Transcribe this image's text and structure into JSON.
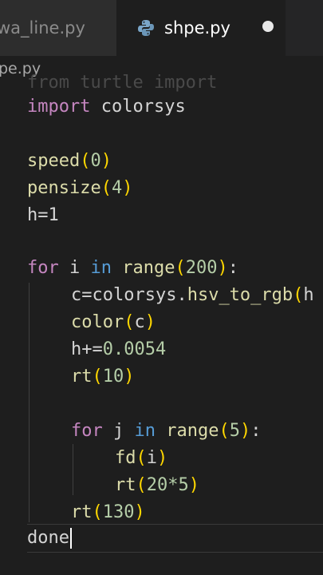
{
  "tabs": [
    {
      "label": "wa_line.py",
      "active": false
    },
    {
      "label": "shpe.py",
      "active": true,
      "dirty": true
    }
  ],
  "breadcrumb": "pe.py",
  "code": {
    "ghost_line": "from turtle import",
    "line_import": {
      "kw": "import",
      "rest": " colorsys"
    },
    "line_speed": {
      "fn": "speed",
      "open": "(",
      "arg": "0",
      "close": ")"
    },
    "line_pensize": {
      "fn": "pensize",
      "open": "(",
      "arg": "4",
      "close": ")"
    },
    "line_h": "h=1",
    "line_for_i": {
      "kw": "for",
      "var": " i ",
      "kw_in": "in",
      "fn": " range",
      "open": "(",
      "arg": "200",
      "close": ")",
      "tail": ":"
    },
    "line_c": {
      "text": "c=colorsys.",
      "fn": "hsv_to_rgb",
      "open": "(",
      "arg": "h"
    },
    "line_color": {
      "fn": "color",
      "open": "(",
      "arg": "c",
      "close": ")"
    },
    "line_hinc": {
      "text": "h+=",
      "num": "0.0054"
    },
    "line_rt10": {
      "fn": "rt",
      "open": "(",
      "arg": "10",
      "close": ")"
    },
    "line_for_j": {
      "kw": "for",
      "var": " j ",
      "kw_in": "in",
      "fn": " range",
      "open": "(",
      "arg": "5",
      "close": ")",
      "tail": ":"
    },
    "line_fd": {
      "fn": "fd",
      "open": "(",
      "arg": "i",
      "close": ")"
    },
    "line_rt20": {
      "fn": "rt",
      "open": "(",
      "arg": "20*5",
      "close": ")"
    },
    "line_rt130": {
      "fn": "rt",
      "open": "(",
      "arg": "130",
      "close": ")"
    },
    "line_done": "done"
  },
  "colors": {
    "background": "#1e1e1e",
    "keyword": "#c586c0",
    "function": "#dcdcaa",
    "number": "#b5cea8",
    "bracket": "#ffd700"
  },
  "icons": [
    "python-icon",
    "unsaved-dot-icon"
  ]
}
